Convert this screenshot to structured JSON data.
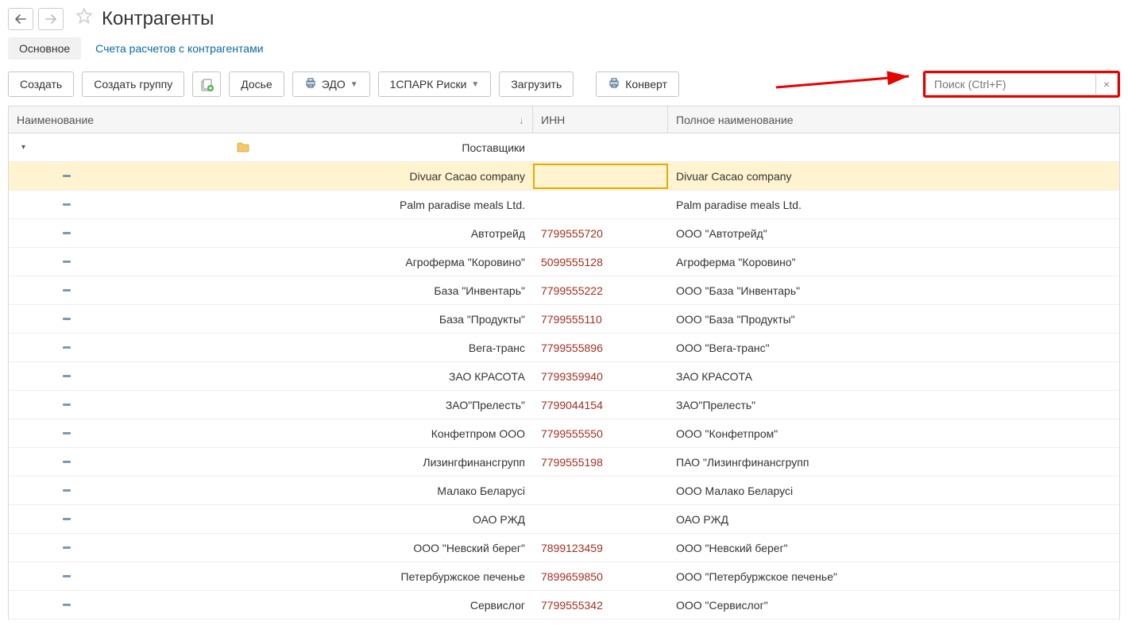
{
  "header": {
    "title": "Контрагенты"
  },
  "tabs": {
    "main": "Основное",
    "accounts": "Счета расчетов с контрагентами"
  },
  "toolbar": {
    "create": "Создать",
    "create_group": "Создать группу",
    "dossier": "Досье",
    "edo": "ЭДО",
    "spark": "1СПАРК Риски",
    "load": "Загрузить",
    "convert": "Конверт"
  },
  "search": {
    "placeholder": "Поиск (Ctrl+F)"
  },
  "columns": {
    "name": "Наименование",
    "inn": "ИНН",
    "full": "Полное наименование"
  },
  "group": {
    "label": "Поставщики"
  },
  "rows": [
    {
      "name": "Divuar Cacao company",
      "inn": "",
      "full": "Divuar Cacao company",
      "selected": true
    },
    {
      "name": "Palm paradise meals Ltd.",
      "inn": "",
      "full": "Palm paradise meals Ltd."
    },
    {
      "name": "Автотрейд",
      "inn": "7799555720",
      "full": "ООО \"Автотрейд\""
    },
    {
      "name": "Агроферма \"Коровино\"",
      "inn": "5099555128",
      "full": "Агроферма \"Коровино\""
    },
    {
      "name": "База \"Инвентарь\"",
      "inn": "7799555222",
      "full": "ООО \"База \"Инвентарь\""
    },
    {
      "name": "База \"Продукты\"",
      "inn": "7799555110",
      "full": "ООО \"База \"Продукты\""
    },
    {
      "name": "Вега-транс",
      "inn": "7799555896",
      "full": "ООО \"Вега-транс\""
    },
    {
      "name": "ЗАО КРАСОТА",
      "inn": "7799359940",
      "full": "ЗАО КРАСОТА"
    },
    {
      "name": "ЗАО\"Прелесть\"",
      "inn": "7799044154",
      "full": "ЗАО\"Прелесть\""
    },
    {
      "name": "Конфетпром ООО",
      "inn": "7799555550",
      "full": "ООО \"Конфетпром\""
    },
    {
      "name": "Лизингфинансгрупп",
      "inn": "7799555198",
      "full": "ПАО \"Лизингфинансгрупп"
    },
    {
      "name": "Малако Беларусі",
      "inn": "",
      "full": "ООО Малако Беларусі"
    },
    {
      "name": "ОАО РЖД",
      "inn": "",
      "full": "ОАО РЖД"
    },
    {
      "name": "ООО \"Невский берег\"",
      "inn": "7899123459",
      "full": "ООО \"Невский берег\""
    },
    {
      "name": "Петербуржское печенье",
      "inn": "7899659850",
      "full": "ООО \"Петербуржское печенье\""
    },
    {
      "name": "Сервислог",
      "inn": "7799555342",
      "full": "ООО \"Сервислог\""
    }
  ]
}
